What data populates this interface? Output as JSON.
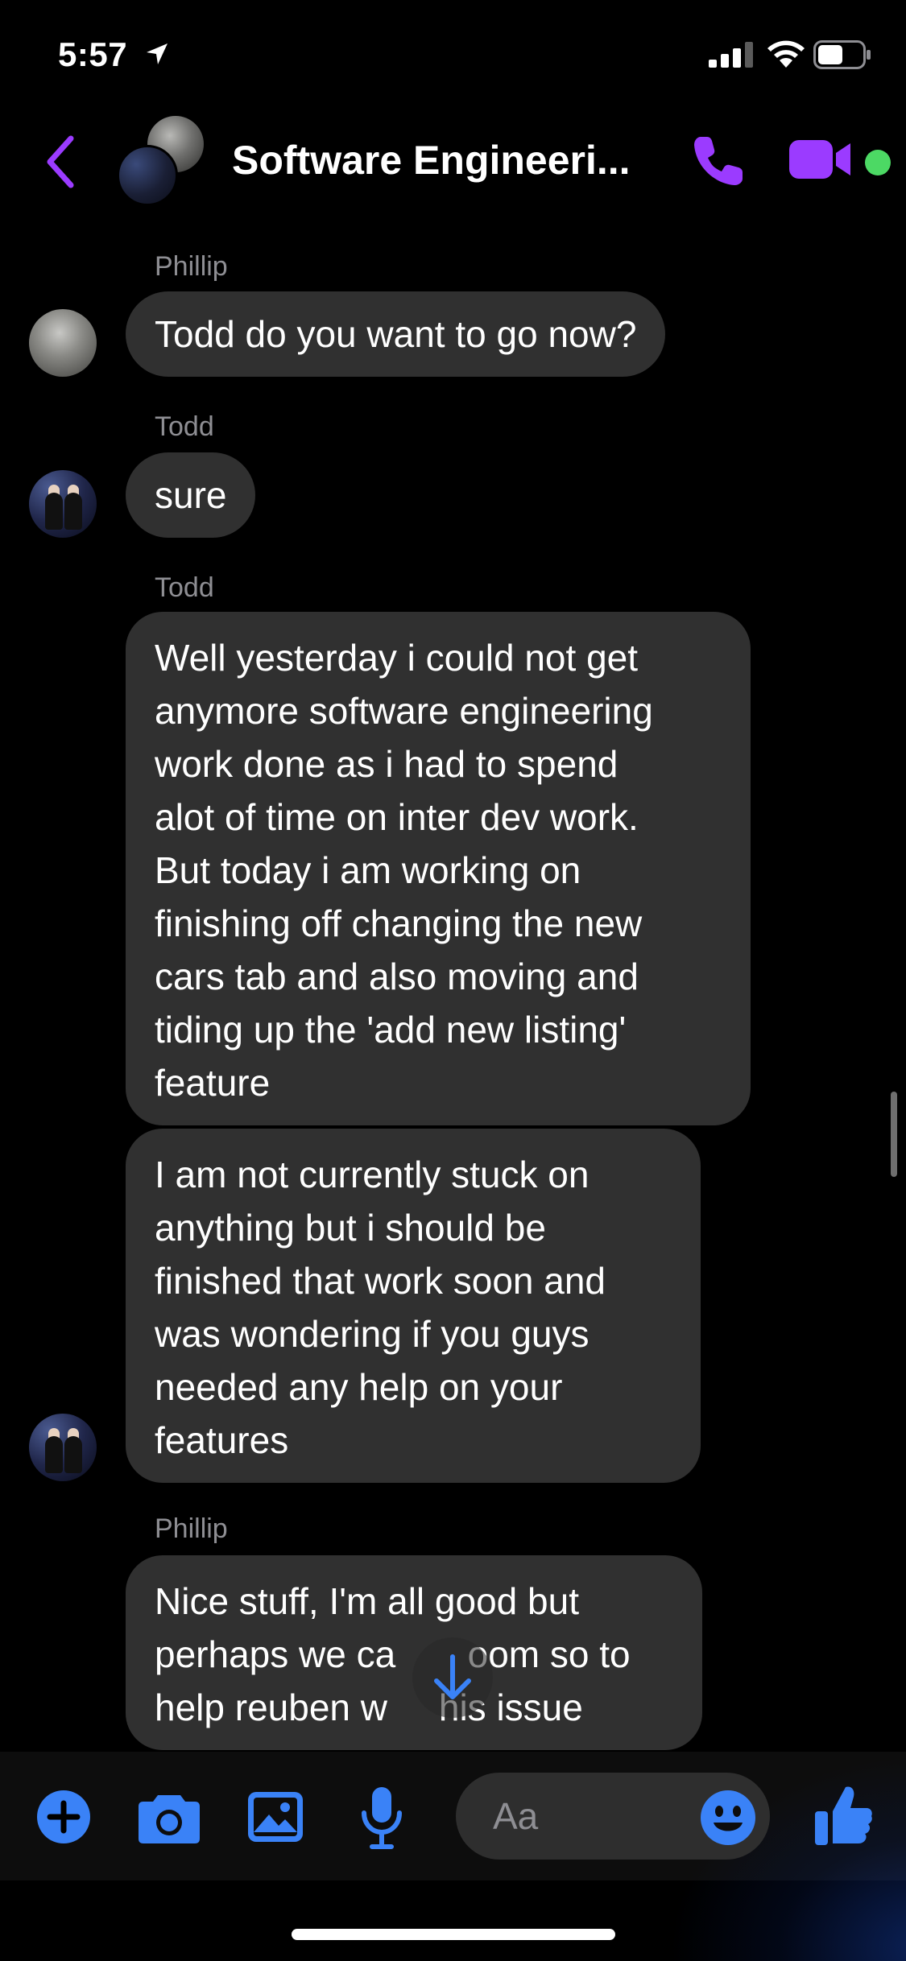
{
  "status_bar": {
    "time": "5:57",
    "icons": [
      "location-arrow-icon",
      "signal-icon",
      "wifi-icon",
      "battery-icon"
    ]
  },
  "header": {
    "title": "Software Engineeri...",
    "accent_color": "#9b3bff",
    "online_color": "#4cd964",
    "icons": [
      "back-chevron-icon",
      "phone-icon",
      "video-camera-icon"
    ]
  },
  "messages": [
    {
      "sender": "Phillip",
      "lines": [
        "Todd do you want to go now?"
      ]
    },
    {
      "sender": "Todd",
      "lines": [
        "sure"
      ]
    },
    {
      "sender": "Todd",
      "lines": [
        "Well yesterday i could not get",
        "anymore software engineering",
        "work done as i had to spend",
        "alot of time on inter dev work.",
        "But today i am working on",
        "finishing off changing the new",
        "cars tab and also moving and",
        "tiding up the 'add new listing'",
        "feature"
      ]
    },
    {
      "sender": "",
      "lines": [
        "I am not currently stuck on",
        "anything but i should be",
        "finished that work soon and",
        "was wondering if you guys",
        "needed any help on your",
        "features"
      ]
    },
    {
      "sender": "Phillip",
      "lines": [
        "Nice stuff, I'm all good but",
        "perhaps we ca       oom so to",
        "help reuben w     his issue"
      ]
    }
  ],
  "composer": {
    "placeholder": "Aa",
    "accent_color": "#3a82f7",
    "icons": [
      "plus-icon",
      "camera-icon",
      "photo-icon",
      "microphone-icon",
      "emoji-icon",
      "thumbs-up-icon"
    ]
  }
}
